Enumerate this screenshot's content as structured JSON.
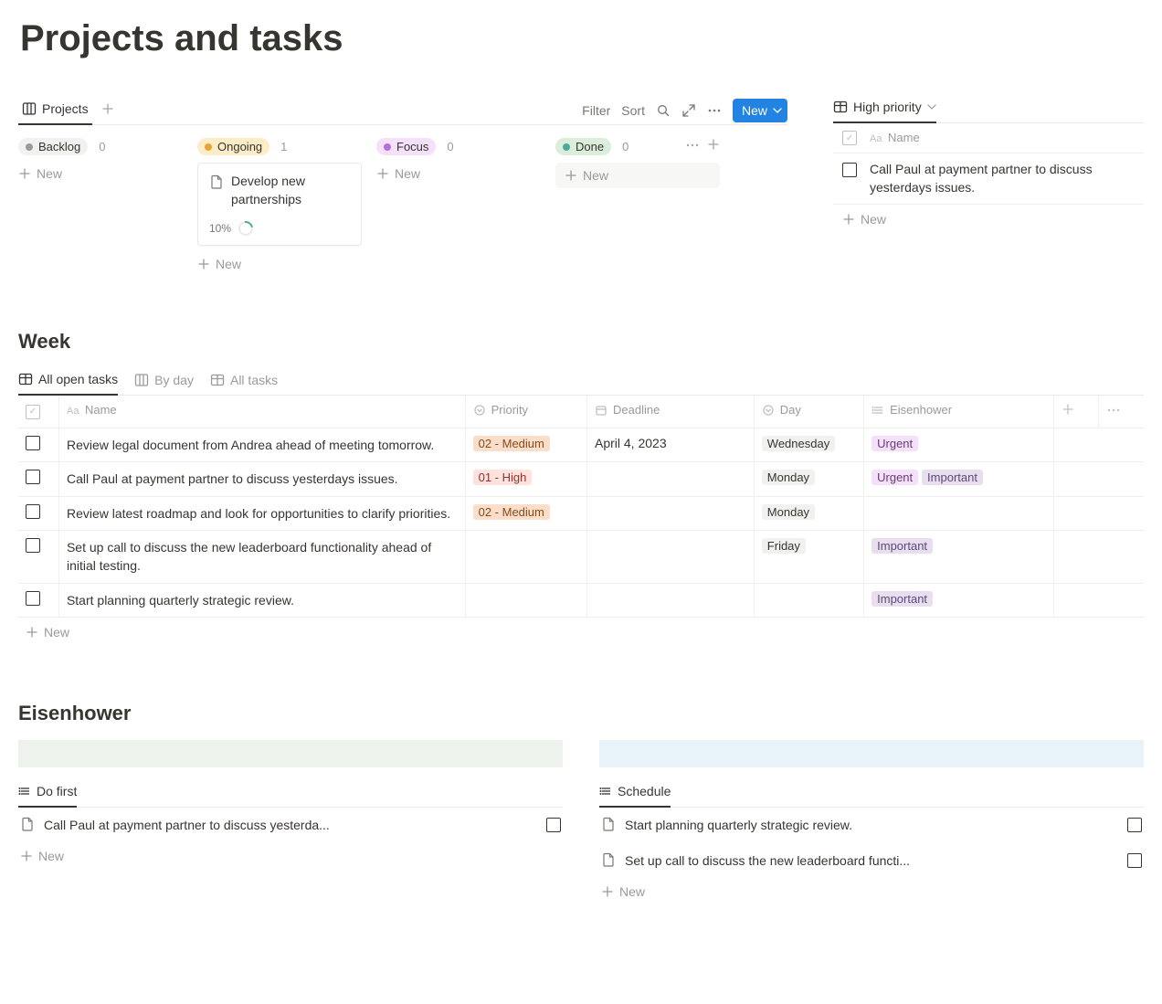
{
  "page": {
    "title": "Projects and tasks"
  },
  "projects": {
    "tab_label": "Projects",
    "toolbar": {
      "filter": "Filter",
      "sort": "Sort",
      "new": "New"
    },
    "columns": [
      {
        "name": "Backlog",
        "count": "0",
        "dot": "#9b9a97",
        "bg": "#f1f1ef"
      },
      {
        "name": "Ongoing",
        "count": "1",
        "dot": "#e9a23b",
        "bg": "#fdecc8"
      },
      {
        "name": "Focus",
        "count": "0",
        "dot": "#b46fda",
        "bg": "#f4e0f8"
      },
      {
        "name": "Done",
        "count": "0",
        "dot": "#4dab9a",
        "bg": "#dbeddb"
      }
    ],
    "ongoing_card": {
      "title": "Develop new partnerships",
      "progress_label": "10%"
    },
    "new_label": "New"
  },
  "high_priority": {
    "tab_label": "High priority",
    "name_header": "Name",
    "row_text": "Call Paul at payment partner to discuss yesterdays issues.",
    "new_label": "New"
  },
  "week": {
    "title": "Week",
    "tabs": {
      "all_open": "All open tasks",
      "by_day": "By day",
      "all": "All tasks"
    },
    "headers": {
      "name": "Name",
      "priority": "Priority",
      "deadline": "Deadline",
      "day": "Day",
      "eisenhower": "Eisenhower"
    },
    "rows": [
      {
        "name": "Review legal document from Andrea ahead of meeting tomorrow.",
        "priority": "02 - Medium",
        "priority_class": "medium",
        "deadline": "April 4, 2023",
        "day": "Wednesday",
        "eisenhower": [
          "Urgent"
        ]
      },
      {
        "name": "Call Paul at payment partner to discuss yesterdays issues.",
        "priority": "01 - High",
        "priority_class": "high",
        "deadline": "",
        "day": "Monday",
        "eisenhower": [
          "Urgent",
          "Important"
        ]
      },
      {
        "name": "Review latest roadmap and look for opportunities to clarify priorities.",
        "priority": "02 - Medium",
        "priority_class": "medium",
        "deadline": "",
        "day": "Monday",
        "eisenhower": []
      },
      {
        "name": "Set up call to discuss the new leaderboard functionality ahead of initial testing.",
        "priority": "",
        "priority_class": "",
        "deadline": "",
        "day": "Friday",
        "eisenhower": [
          "Important"
        ]
      },
      {
        "name": "Start planning quarterly strategic review.",
        "priority": "",
        "priority_class": "",
        "deadline": "",
        "day": "",
        "eisenhower": [
          "Important"
        ]
      }
    ],
    "new_label": "New"
  },
  "eisenhower": {
    "title": "Eisenhower",
    "do_first": {
      "tab": "Do first",
      "items": [
        "Call Paul at payment partner to discuss yesterda..."
      ],
      "new_label": "New"
    },
    "schedule": {
      "tab": "Schedule",
      "items": [
        "Start planning quarterly strategic review.",
        "Set up call to discuss the new leaderboard functi..."
      ],
      "new_label": "New"
    }
  }
}
